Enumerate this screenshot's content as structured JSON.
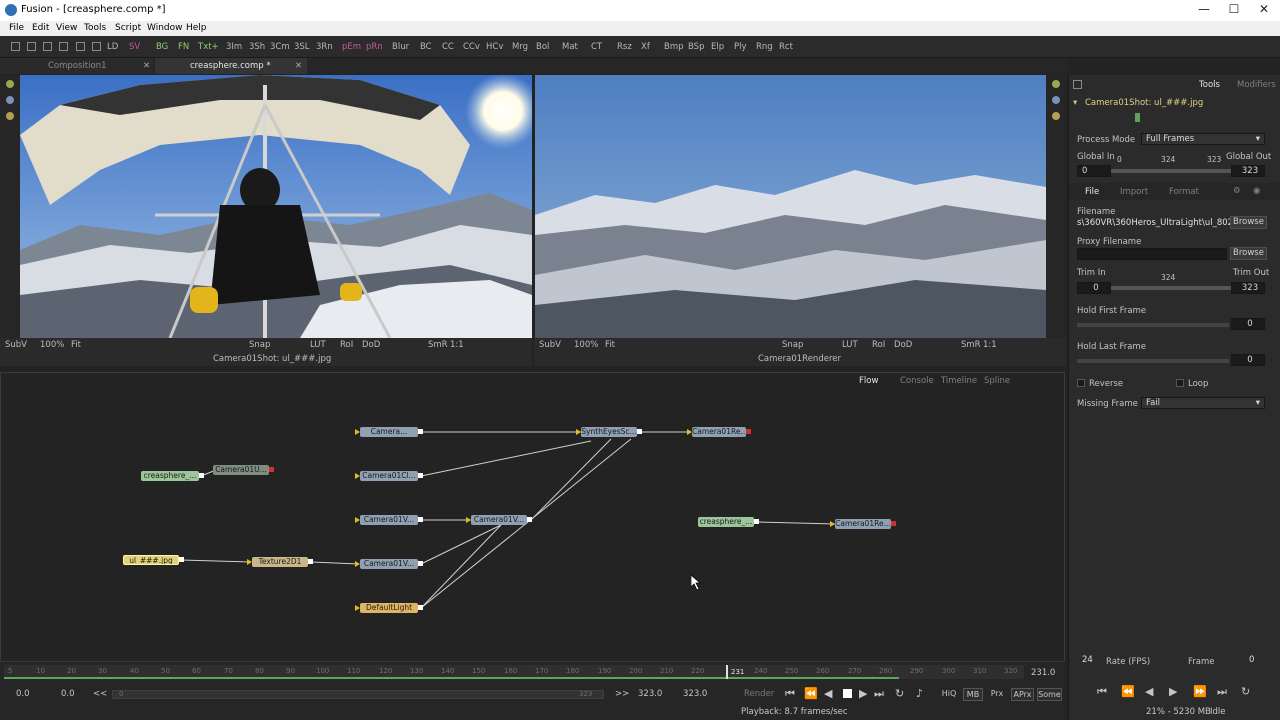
{
  "window": {
    "title": "Fusion - [creasphere.comp *]",
    "controls": [
      "—",
      "☐",
      "✕"
    ]
  },
  "menu": [
    "File",
    "Edit",
    "View",
    "Tools",
    "Script",
    "Window",
    "Help"
  ],
  "toolbar": {
    "items": [
      "LD",
      "SV",
      "BG",
      "FN",
      "Txt+",
      "3Im",
      "3Sh",
      "3Cm",
      "3SL",
      "3Rn",
      "pEm",
      "pRn",
      "Blur",
      "BC",
      "CC",
      "CCv",
      "HCv",
      "Mrg",
      "Bol",
      "Mat",
      "CT",
      "Rsz",
      "Xf",
      "Bmp",
      "BSp",
      "Elp",
      "Ply",
      "Rng",
      "Rct"
    ]
  },
  "tabs": [
    {
      "label": "Composition1",
      "close": "✕"
    },
    {
      "label": "creasphere.comp *",
      "close": "✕"
    }
  ],
  "viewer_left": {
    "controls": [
      "SubV",
      "100%",
      "Fit",
      "LUT",
      "RoI",
      "DoD",
      "Snap",
      "SmR",
      "1:1"
    ],
    "caption": "Camera01Shot: ul_###.jpg"
  },
  "viewer_right": {
    "controls": [
      "SubV",
      "100%",
      "Fit",
      "LUT",
      "RoI",
      "DoD",
      "Snap",
      "SmR",
      "1:1"
    ],
    "caption": "Camera01Renderer"
  },
  "panel": {
    "tabs": [
      "Tools",
      "Modifiers"
    ],
    "tool_name": "Camera01Shot: ul_###.jpg",
    "process_mode_label": "Process Mode",
    "process_mode_value": "Full Frames",
    "global_in_label": "Global In",
    "global_out_label": "Global Out",
    "global_in": "0",
    "global_out": "323",
    "global_ticks": [
      "0",
      "324",
      "323"
    ],
    "subtabs": [
      "File",
      "Import",
      "Format"
    ],
    "filename_label": "Filename",
    "filename_value": "s\\360VR\\360Heros_UltraLight\\ul_802.jpg",
    "browse": "Browse",
    "proxy_label": "Proxy Filename",
    "trim_in_label": "Trim In",
    "trim_out_label": "Trim Out",
    "trim_mid": "324",
    "trim_in": "0",
    "trim_out": "323",
    "hold_first_label": "Hold First Frame",
    "hold_first": "0",
    "hold_last_label": "Hold Last Frame",
    "hold_last": "0",
    "reverse_label": "Reverse",
    "loop_label": "Loop",
    "missing_frame_label": "Missing Frame",
    "missing_frame_value": "Fail"
  },
  "flow": {
    "tabs": [
      "Flow",
      "Console",
      "Timeline",
      "Spline"
    ],
    "nodes": {
      "n1": "Camera...",
      "n2": "Camera01Cl...",
      "n3": "Camera01V...",
      "n4": "Camera01V...",
      "n5": "Camera01V...",
      "n6": "DefaultLight",
      "n7": "SynthEyesSc...",
      "n8": "Camera01Re...",
      "n9": "creasphere_...",
      "n10": "Camera01U...",
      "n11": "ul_###.jpg",
      "n12": "Texture2D1",
      "n13": "creasphere_...",
      "n14": "Camera01Re..."
    }
  },
  "timeline": {
    "ticks": [
      "5",
      "10",
      "20",
      "30",
      "40",
      "50",
      "60",
      "70",
      "80",
      "90",
      "100",
      "110",
      "120",
      "130",
      "140",
      "150",
      "160",
      "170",
      "180",
      "190",
      "200",
      "210",
      "220",
      "240",
      "250",
      "260",
      "270",
      "280",
      "290",
      "300",
      "310",
      "320"
    ],
    "playhead": "231",
    "end_value": "231.0",
    "start": "0.0",
    "start2": "0.0",
    "back": "<<",
    "range_start": "0",
    "range_end": "323",
    "fwd": ">>",
    "end1": "323.0",
    "end2": "323.0",
    "render": "Render",
    "toggles": [
      "HiQ",
      "MB",
      "Prx",
      "APrx",
      "Some"
    ],
    "playback": "Playback: 8.7 frames/sec"
  },
  "fps_panel": {
    "fps_value": "24",
    "fps_label": "Rate (FPS)",
    "frame_label": "Frame",
    "frame_value": "0"
  },
  "status": {
    "memory": "21% - 5230 MB",
    "state": "Idle"
  }
}
